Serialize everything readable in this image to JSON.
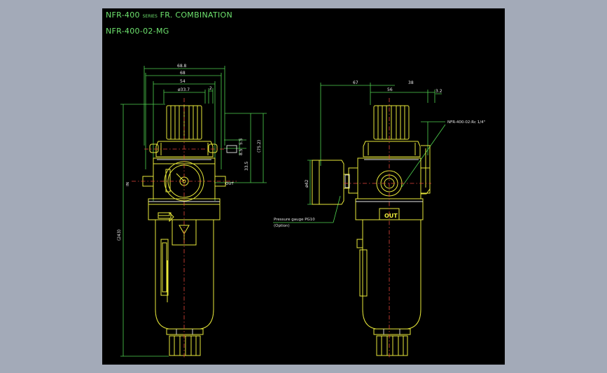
{
  "drawing": {
    "title_main": "NFR-400",
    "title_series": "SERIES",
    "title_rest": "FR. COMBINATION",
    "model": "NFR-400-02-MG"
  },
  "dimensions": {
    "d1": "68.8",
    "d2": "68",
    "d3": "54",
    "d4": "ø33.7",
    "d5": "2",
    "d6": "5.5",
    "d7": "8.5",
    "d8": "(75.2)",
    "d9": "33.5",
    "d10": "(243)",
    "d11": "67",
    "d12": "56",
    "d13": "38",
    "d14": "3.2",
    "d15": "ø42"
  },
  "labels": {
    "port_in": "IN",
    "port_out": "OUT",
    "out_plate": "OUT",
    "pipe_note": "NFR-400-02:Rc 1/4\"",
    "gauge_note": "Pressure gauge PG10",
    "gauge_option": "(Option)"
  },
  "colors": {
    "background": "#000000",
    "frame": "#a3aab8",
    "outline": "#e8e83a",
    "dimension": "#4fd24f",
    "centerline": "#e8463a",
    "text": "#e8e8e8",
    "title": "#6ee36e"
  }
}
